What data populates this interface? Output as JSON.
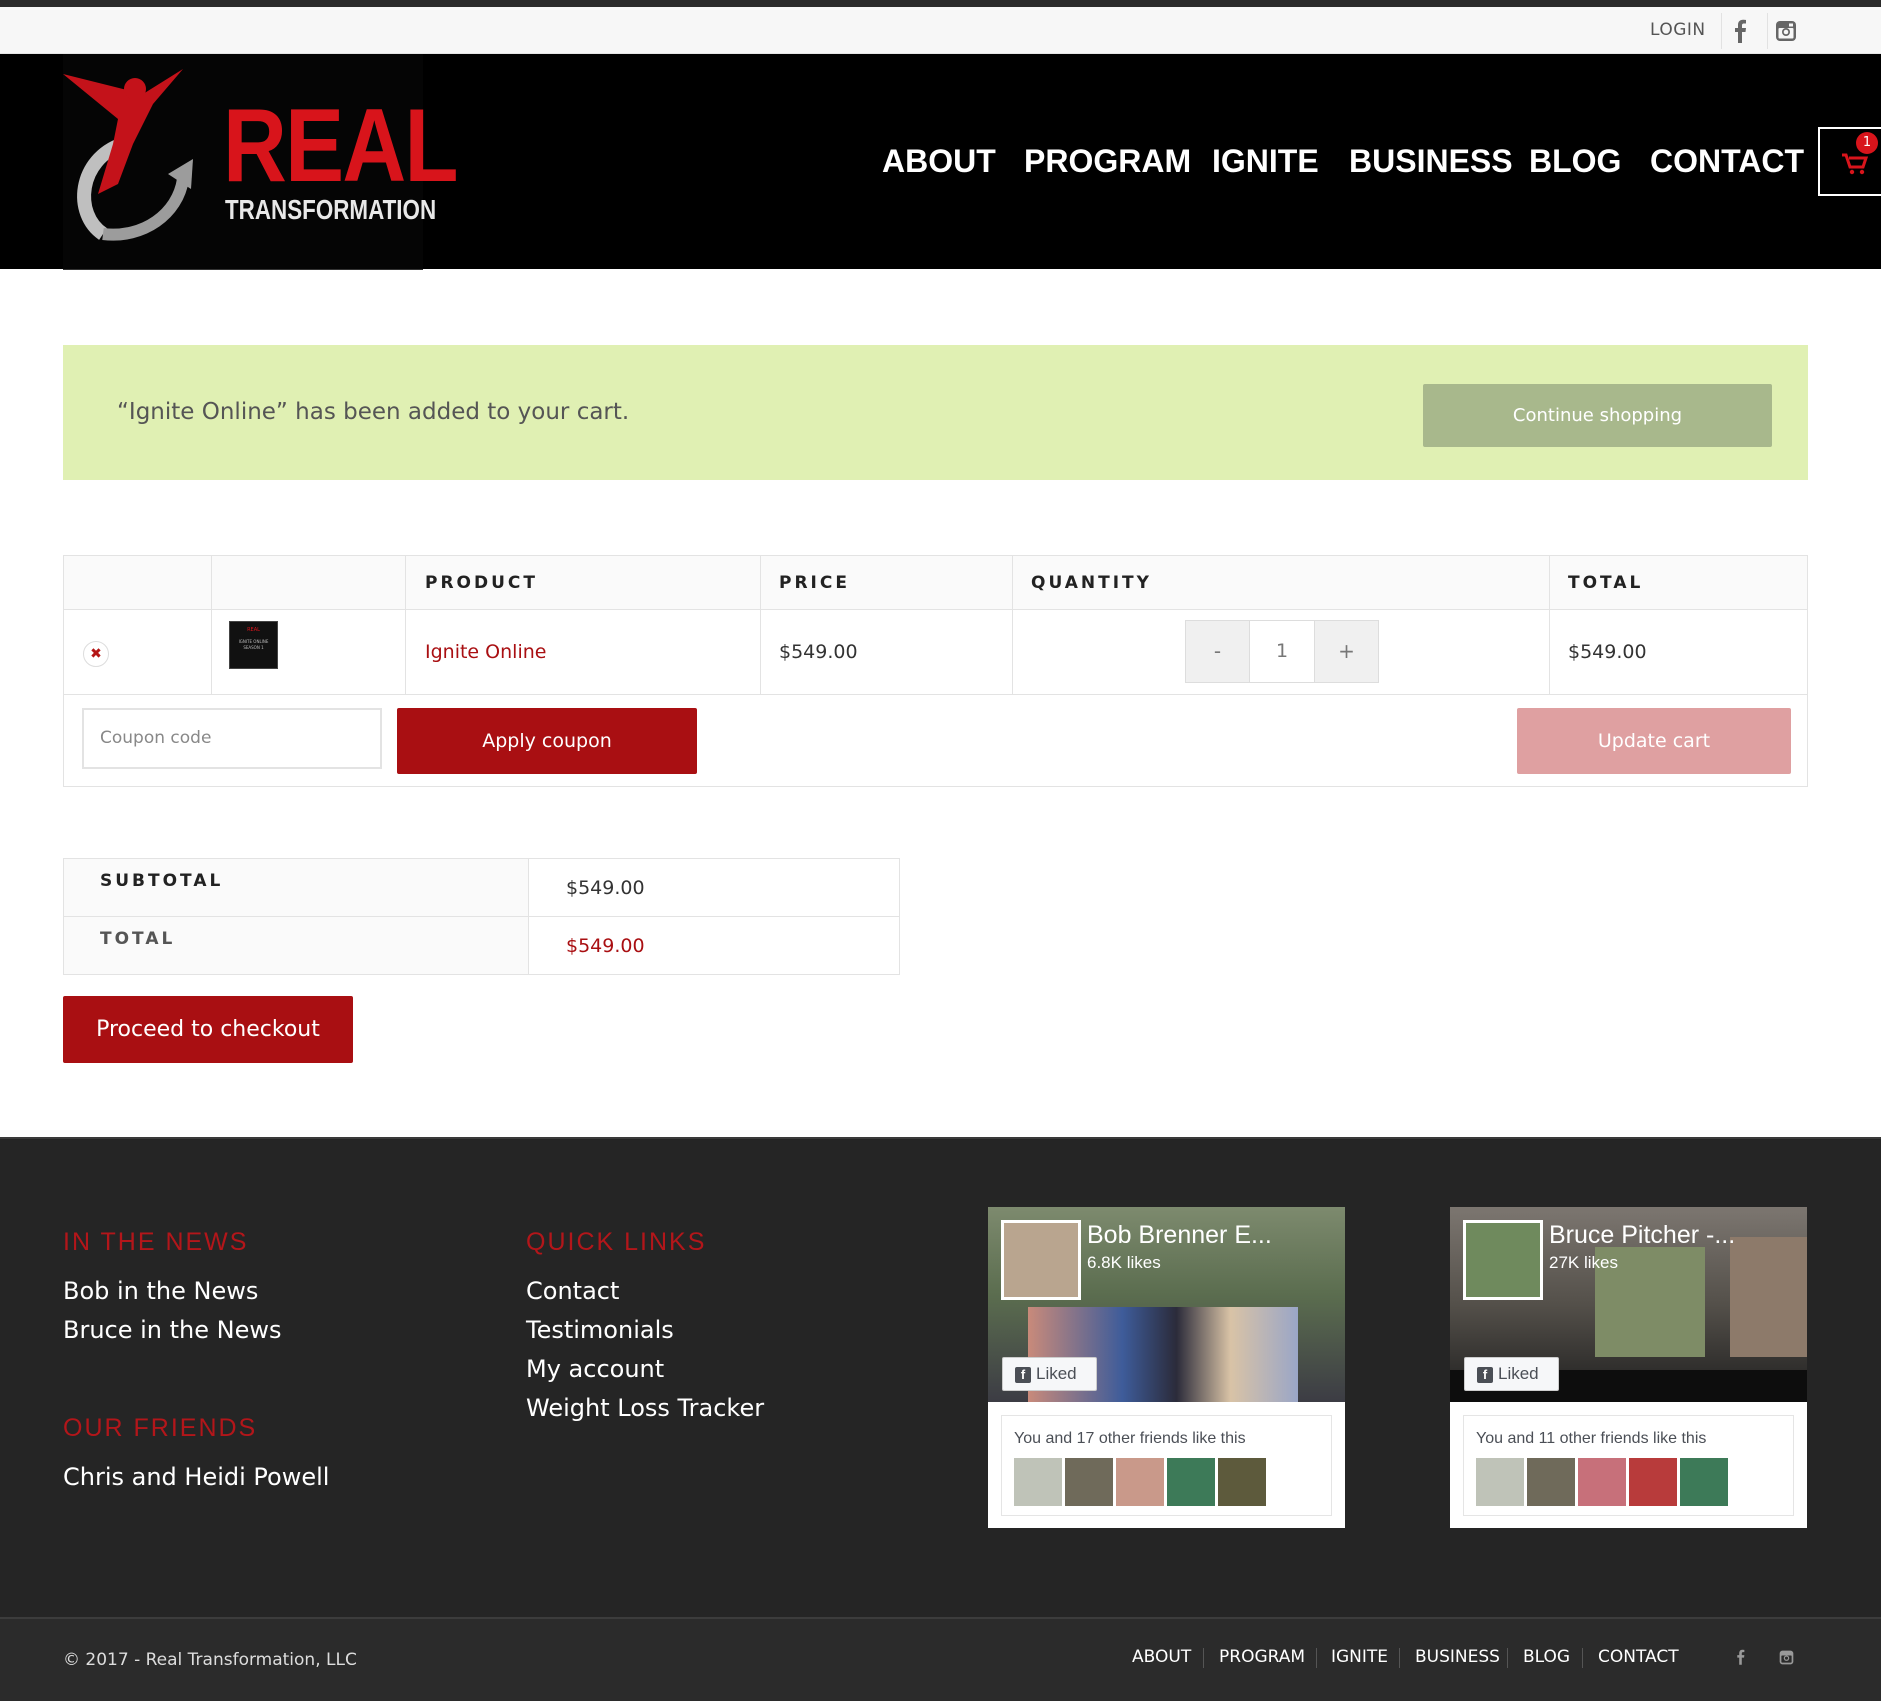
{
  "topbar": {
    "login": "LOGIN",
    "facebook_icon": "facebook-icon",
    "instagram_icon": "instagram-icon"
  },
  "brand": {
    "word1": "REAL",
    "word2": "TRANSFORMATION",
    "accent": "#d8141b"
  },
  "nav": {
    "items": [
      "ABOUT",
      "PROGRAM",
      "IGNITE",
      "BUSINESS",
      "BLOG",
      "CONTACT"
    ],
    "cart_count": "1"
  },
  "notice": {
    "message": "“Ignite Online” has been added to your cart.",
    "button": "Continue shopping"
  },
  "cart": {
    "headers": {
      "product": "PRODUCT",
      "price": "PRICE",
      "quantity": "QUANTITY",
      "total": "TOTAL"
    },
    "item": {
      "thumb_lines": [
        "IGNITE ONLINE",
        "SEASON 1"
      ],
      "name": "Ignite Online",
      "price": "$549.00",
      "qty_minus": "-",
      "quantity": "1",
      "qty_plus": "+",
      "total": "$549.00"
    },
    "coupon_placeholder": "Coupon code",
    "apply": "Apply coupon",
    "update": "Update cart"
  },
  "totals": {
    "subtotal_label": "SUBTOTAL",
    "subtotal": "$549.00",
    "total_label": "TOTAL",
    "total": "$549.00",
    "checkout": "Proceed to checkout"
  },
  "footer": {
    "news_heading": "IN THE NEWS",
    "news_links": [
      "Bob in the News",
      "Bruce in the News"
    ],
    "friends_heading": "OUR FRIENDS",
    "friends_links": [
      "Chris and Heidi Powell"
    ],
    "quick_heading": "QUICK LINKS",
    "quick_links": [
      "Contact",
      "Testimonials",
      "My account",
      "Weight Loss Tracker"
    ],
    "fb_pages": [
      {
        "name": "Bob Brenner E...",
        "likes": "6.8K likes",
        "liked": "Liked",
        "friends": "You and 17 other friends like this"
      },
      {
        "name": "Bruce Pitcher -...",
        "likes": "27K likes",
        "liked": "Liked",
        "friends": "You and 11 other friends like this"
      }
    ]
  },
  "bottom": {
    "copyright": "© 2017 - Real Transformation, LLC",
    "nav": [
      "ABOUT",
      "PROGRAM",
      "IGNITE",
      "BUSINESS",
      "BLOG",
      "CONTACT"
    ]
  }
}
